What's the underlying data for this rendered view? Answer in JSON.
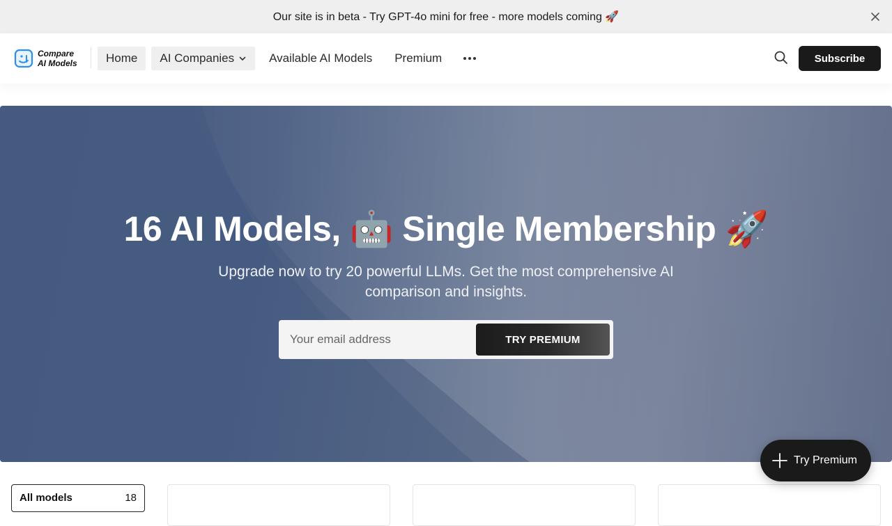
{
  "announcement": {
    "text": "Our site is in beta - Try GPT-4o mini for free - more models coming 🚀"
  },
  "brand": {
    "line1": "Compare",
    "line2": "AI Models",
    "accent": "#2d8fe8"
  },
  "nav": {
    "items": [
      {
        "label": "Home"
      },
      {
        "label": "AI Companies"
      },
      {
        "label": "Available AI Models"
      },
      {
        "label": "Premium"
      }
    ],
    "more_icon": "ellipsis-icon"
  },
  "header": {
    "search_icon": "search-icon",
    "subscribe_label": "Subscribe"
  },
  "hero": {
    "title": "16 AI Models, 🤖 Single Membership 🚀",
    "subtitle": "Upgrade now to try 20 powerful LLMs. Get the most comprehensive AI comparison and insights.",
    "email_placeholder": "Your email address",
    "cta_label": "TRY PREMIUM"
  },
  "filter": {
    "label": "All models",
    "count": "18"
  },
  "fab": {
    "label": "Try Premium"
  },
  "colors": {
    "dark": "#1a1a1a",
    "hero_blue": "#4b5f84",
    "announce_bg": "#efefef"
  }
}
